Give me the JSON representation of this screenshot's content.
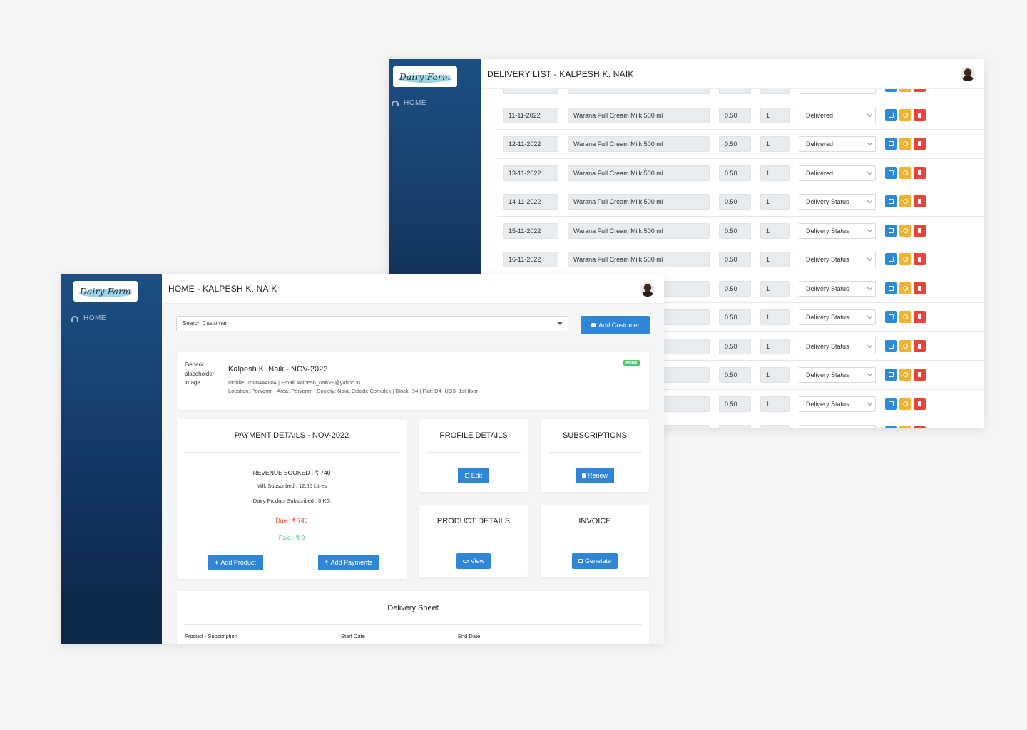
{
  "brand": {
    "logo_text": "Dairy Farm"
  },
  "nav": {
    "home_label": "HOME"
  },
  "delivery_window": {
    "title": "DELIVERY LIST - KALPESH K. NAIK",
    "rows": [
      {
        "date": "11-11-2022",
        "product": "Warana Full Cream Milk 500 ml",
        "rate": "0.50",
        "qty": "1",
        "status": "Delivered"
      },
      {
        "date": "12-11-2022",
        "product": "Warana Full Cream Milk 500 ml",
        "rate": "0.50",
        "qty": "1",
        "status": "Delivered"
      },
      {
        "date": "13-11-2022",
        "product": "Warana Full Cream Milk 500 ml",
        "rate": "0.50",
        "qty": "1",
        "status": "Delivered"
      },
      {
        "date": "14-11-2022",
        "product": "Warana Full Cream Milk 500 ml",
        "rate": "0.50",
        "qty": "1",
        "status": "Delivery Status"
      },
      {
        "date": "15-11-2022",
        "product": "Warana Full Cream Milk 500 ml",
        "rate": "0.50",
        "qty": "1",
        "status": "Delivery Status"
      },
      {
        "date": "16-11-2022",
        "product": "Warana Full Cream Milk 500 ml",
        "rate": "0.50",
        "qty": "1",
        "status": "Delivery Status"
      },
      {
        "date": "",
        "product": "",
        "rate": "0.50",
        "qty": "1",
        "status": "Delivery Status"
      },
      {
        "date": "",
        "product": "",
        "rate": "0.50",
        "qty": "1",
        "status": "Delivery Status"
      },
      {
        "date": "",
        "product": "",
        "rate": "0.50",
        "qty": "1",
        "status": "Delivery Status"
      },
      {
        "date": "",
        "product": "",
        "rate": "0.50",
        "qty": "1",
        "status": "Delivery Status"
      },
      {
        "date": "",
        "product": "",
        "rate": "0.50",
        "qty": "1",
        "status": "Delivery Status"
      }
    ]
  },
  "home_window": {
    "title": "HOME - KALPESH K. NAIK",
    "search": {
      "placeholder": "Search Customer"
    },
    "add_customer_label": "Add Customer",
    "customer": {
      "image_alt": "Generic placeholder image",
      "name": "Kalpesh K. Naik - NOV-2022",
      "contact_line": "Mobile: 7588444884 |   Email: kalpesh_naik29@yahoo.in",
      "location_line": "Location: Porvorim |   Area: Porvorim |   Society: Nova Cidade Complex |   Block: D4 |   Flat: D4- UG3- 1st floor",
      "status_badge": "Active"
    },
    "payment": {
      "title": "PAYMENT DETAILS - NOV-2022",
      "revenue": "REVENUE BOOKED : ₹ 740",
      "milk_subscribed": "Milk Subscribed : 12.50 Litres",
      "dairy_subscribed": "Dairy Product Subscribed : 0 KG",
      "due": "Due : ₹ 740",
      "paid": "Paid : ₹ 0",
      "add_product_label": "Add Product",
      "add_payments_label": "Add Payments"
    },
    "profile": {
      "title": "PROFILE DETAILS",
      "button_label": "Edit"
    },
    "subscriptions": {
      "title": "SUBSCRIPTIONS",
      "button_label": "Renew"
    },
    "product_details": {
      "title": "PRODUCT DETAILS",
      "button_label": "View"
    },
    "invoice": {
      "title": "INVOICE",
      "button_label": "Genetate"
    },
    "delivery_sheet": {
      "title": "Delivery Sheet",
      "columns": [
        "Product - Subscription",
        "Start Date",
        "End Date"
      ]
    }
  },
  "colors": {
    "sidebar": "#17406d",
    "primary": "#2f86d6",
    "warning": "#f4b233",
    "danger": "#e8443a",
    "success": "#4cc46a"
  }
}
